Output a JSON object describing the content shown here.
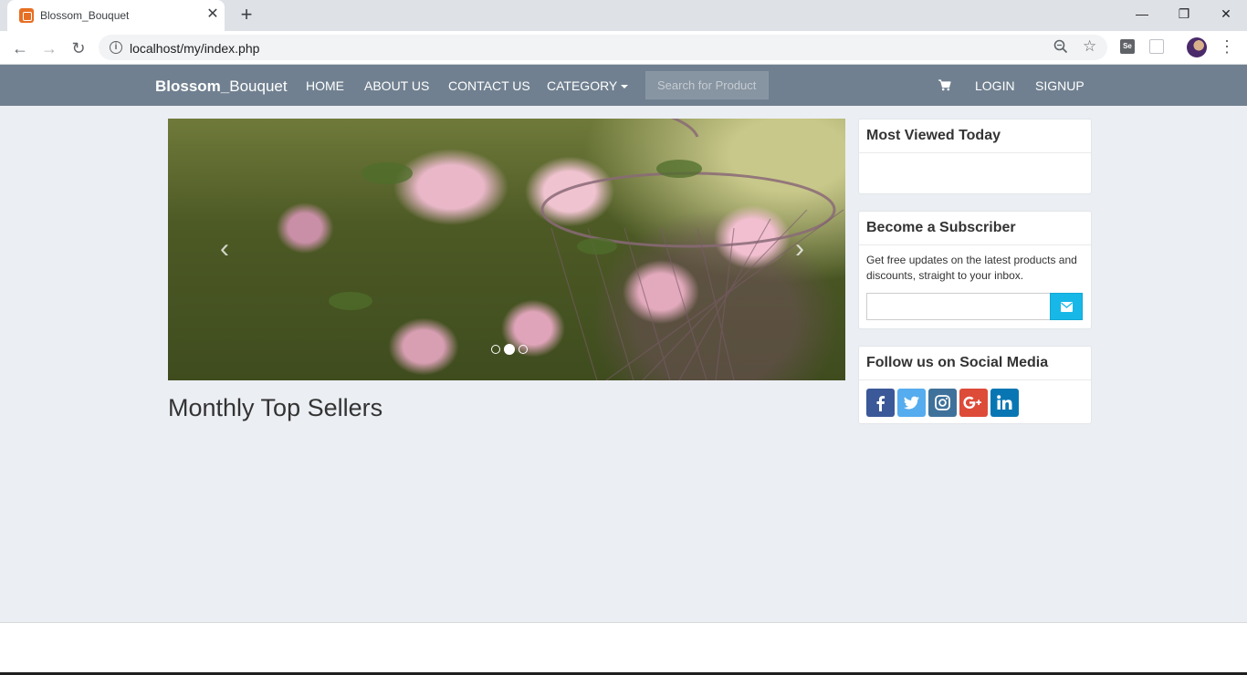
{
  "browser": {
    "tab_title": "Blossom_Bouquet",
    "tab_close": "✕",
    "new_tab": "+",
    "url": "localhost/my/index.php"
  },
  "navbar": {
    "brand_bold": "Blossom_",
    "brand_rest": "Bouquet",
    "links": [
      "HOME",
      "ABOUT US",
      "CONTACT US",
      "CATEGORY"
    ],
    "search_placeholder": "Search for Product",
    "login": "LOGIN",
    "signup": "SIGNUP"
  },
  "carousel": {
    "prev_label": "‹",
    "next_label": "›",
    "slide_count": 3,
    "active_slide": 2
  },
  "main": {
    "section_title": "Monthly Top Sellers"
  },
  "sidebar": {
    "most_viewed_title": "Most Viewed Today",
    "subscriber_title": "Become a Subscriber",
    "subscriber_text": "Get free updates on the latest products and discounts, straight to your inbox.",
    "social_title": "Follow us on Social Media",
    "social_networks": [
      {
        "name": "facebook",
        "color": "#3b5998"
      },
      {
        "name": "twitter",
        "color": "#55acee"
      },
      {
        "name": "instagram",
        "color": "#3f729b"
      },
      {
        "name": "google-plus",
        "color": "#dd4b39"
      },
      {
        "name": "linkedin",
        "color": "#0976b4"
      }
    ],
    "subscribe_button_color": "#17b8e8"
  },
  "colors": {
    "navbar": "#708090",
    "page_background": "#ebeef3"
  }
}
